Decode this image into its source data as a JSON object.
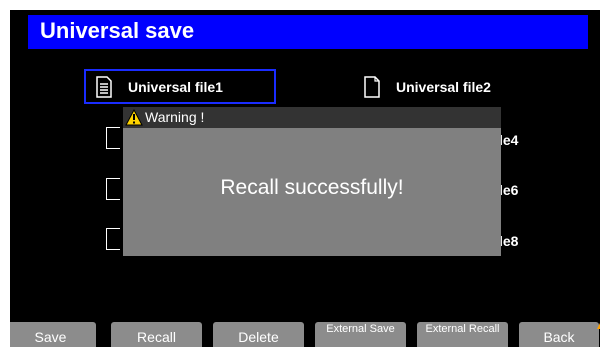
{
  "title": "Universal save",
  "files": [
    {
      "label": "Universal file1",
      "selected": true,
      "icon": "file-filled-icon"
    },
    {
      "label": "Universal file2",
      "selected": false,
      "icon": "file-empty-icon"
    }
  ],
  "partial_labels": [
    "le4",
    "le6",
    "le8"
  ],
  "dialog": {
    "title": "Warning !",
    "message": "Recall successfully!"
  },
  "softkeys": [
    {
      "label": "Save"
    },
    {
      "label": "Recall"
    },
    {
      "label": "Delete"
    },
    {
      "label": "External Save"
    },
    {
      "label": "External Recall"
    },
    {
      "label": "Back"
    }
  ],
  "colors": {
    "title_bg": "#0000ff",
    "selection": "#1a2cff",
    "dialog_body": "#808080",
    "dialog_header": "#333333",
    "softkey": "#8c8c8c"
  }
}
